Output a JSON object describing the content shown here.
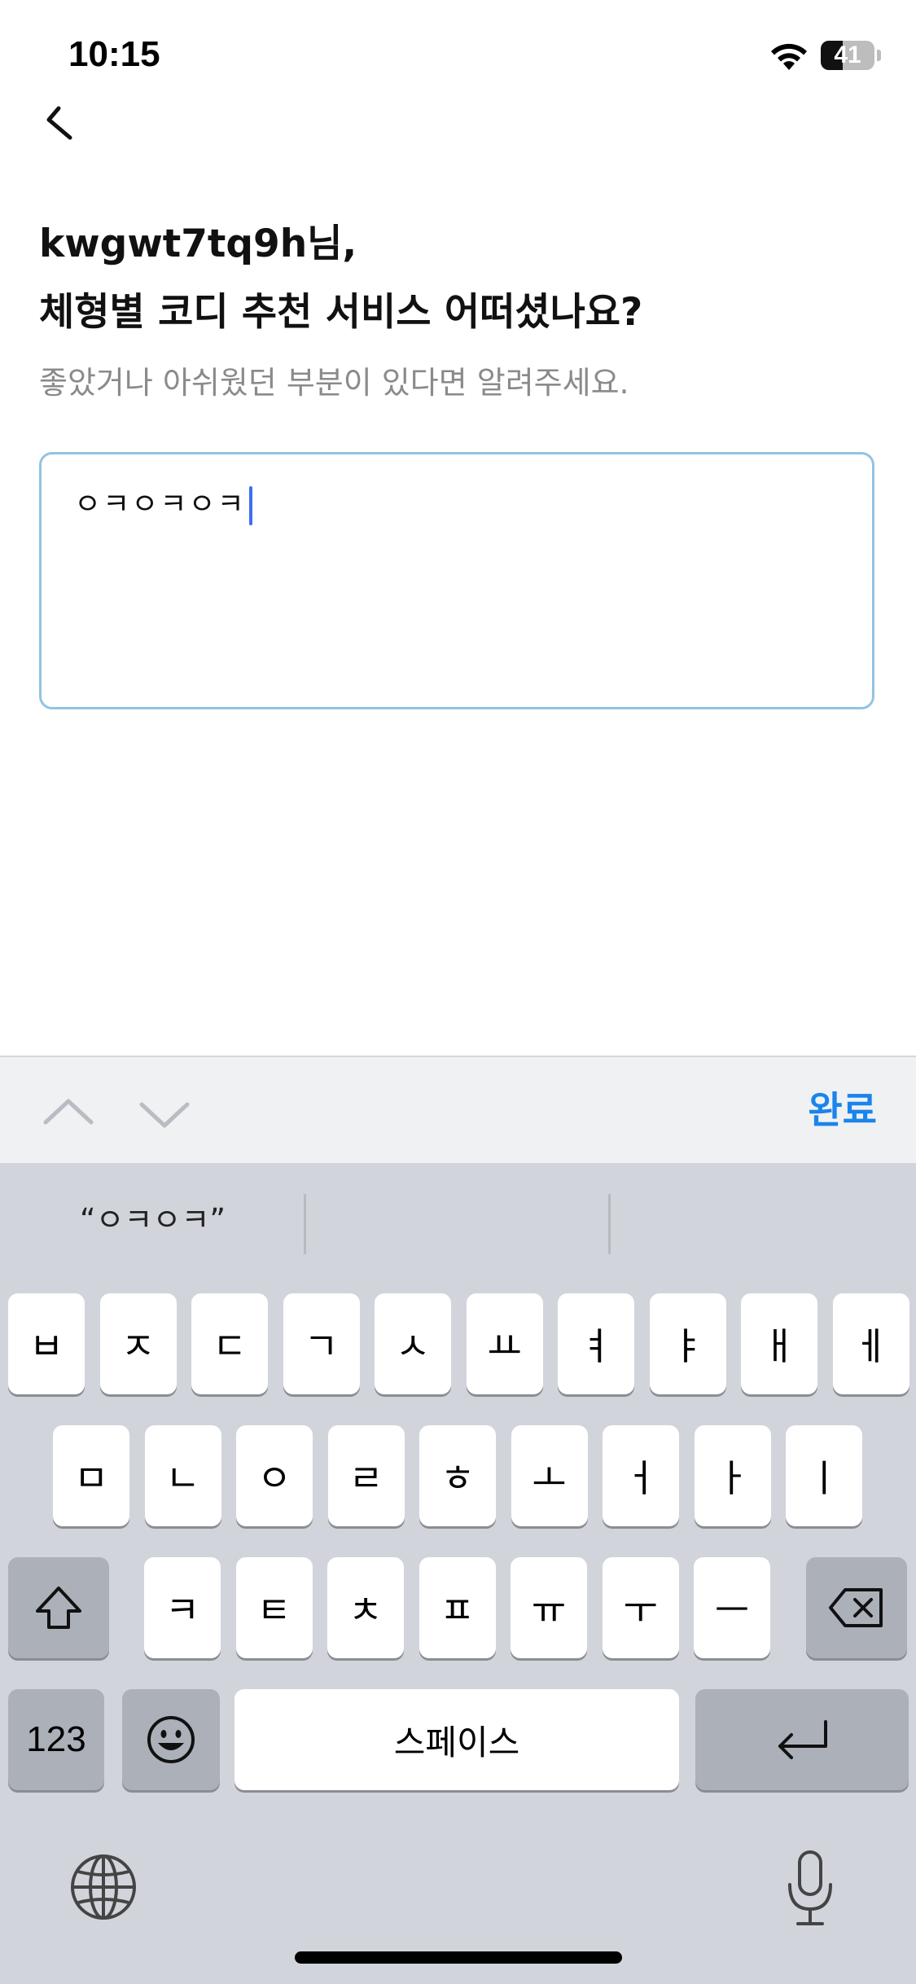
{
  "status_bar": {
    "time": "10:15",
    "battery_level": "41",
    "battery_fraction": 0.41,
    "icons": [
      "wifi-icon",
      "battery-icon"
    ]
  },
  "header": {
    "back_icon": "chevron-left-icon"
  },
  "content": {
    "title_line1": "kwgwt7tq9h님,",
    "title_line2": "체형별 코디 추천 서비스 어떠셨나요?",
    "subtitle": "좋았거나 아쉬웠던 부분이 있다면 알려주세요.",
    "feedback_value": "ㅇㅋㅇㅋㅇㅋ"
  },
  "keyboard_toolbar": {
    "prev_icon": "chevron-up-icon",
    "next_icon": "chevron-down-icon",
    "done_label": "완료"
  },
  "keyboard": {
    "suggestions": [
      "“ㅇㅋㅇㅋ”",
      "",
      ""
    ],
    "row1": [
      "ㅂ",
      "ㅈ",
      "ㄷ",
      "ㄱ",
      "ㅅ",
      "ㅛ",
      "ㅕ",
      "ㅑ",
      "ㅐ",
      "ㅔ"
    ],
    "row2": [
      "ㅁ",
      "ㄴ",
      "ㅇ",
      "ㄹ",
      "ㅎ",
      "ㅗ",
      "ㅓ",
      "ㅏ",
      "ㅣ"
    ],
    "row3": [
      "ㅋ",
      "ㅌ",
      "ㅊ",
      "ㅍ",
      "ㅠ",
      "ㅜ",
      "ㅡ"
    ],
    "shift_icon": "shift-icon",
    "delete_icon": "backspace-icon",
    "numbers_label": "123",
    "emoji_icon": "emoji-icon",
    "space_label": "스페이스",
    "return_icon": "return-icon",
    "globe_icon": "globe-icon",
    "mic_icon": "microphone-icon"
  }
}
